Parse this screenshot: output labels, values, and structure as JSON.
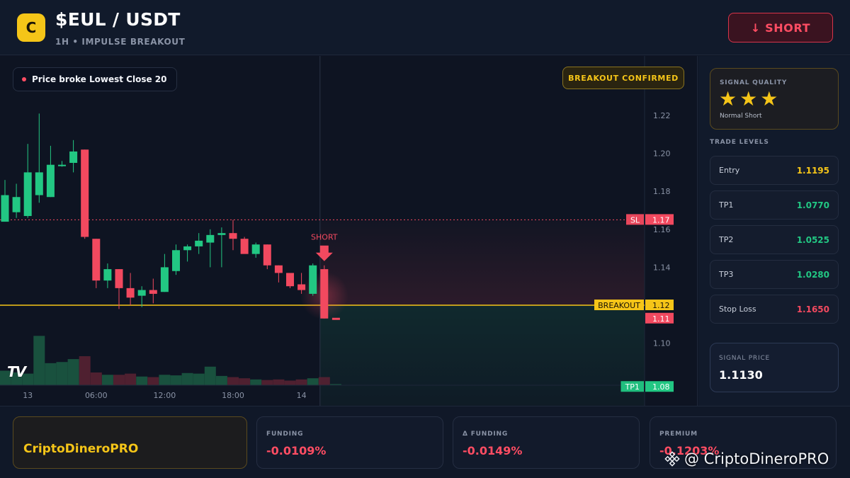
{
  "header": {
    "logo_letter": "C",
    "pair": "$EUL / USDT",
    "subtitle": "1H • IMPULSE BREAKOUT",
    "short_label": "↓ SHORT"
  },
  "chart": {
    "alert_text": "Price broke Lowest Close 20",
    "confirm_text": "BREAKOUT CONFIRMED",
    "short_marker": "SHORT",
    "tv_logo": "TV",
    "colors": {
      "up": "#22c783",
      "down": "#f2495f",
      "breakout": "#f5c518"
    }
  },
  "chart_data": {
    "type": "candlestick",
    "timeframe": "1H",
    "y_ticks": [
      "1.22",
      "1.20",
      "1.18",
      "1.16",
      "1.14",
      "1.10"
    ],
    "ylim": [
      1.075,
      1.235
    ],
    "x_ticks": [
      "13",
      "06:00",
      "12:00",
      "18:00",
      "14"
    ],
    "candles": [
      {
        "o": 1.164,
        "h": 1.186,
        "l": 1.165,
        "c": 1.178
      },
      {
        "o": 1.169,
        "h": 1.184,
        "l": 1.166,
        "c": 1.177
      },
      {
        "o": 1.167,
        "h": 1.205,
        "l": 1.166,
        "c": 1.19
      },
      {
        "o": 1.178,
        "h": 1.221,
        "l": 1.174,
        "c": 1.19
      },
      {
        "o": 1.177,
        "h": 1.204,
        "l": 1.177,
        "c": 1.194
      },
      {
        "o": 1.194,
        "h": 1.196,
        "l": 1.193,
        "c": 1.194
      },
      {
        "o": 1.195,
        "h": 1.207,
        "l": 1.19,
        "c": 1.201
      },
      {
        "o": 1.202,
        "h": 1.202,
        "l": 1.155,
        "c": 1.156
      },
      {
        "o": 1.155,
        "h": 1.155,
        "l": 1.129,
        "c": 1.133
      },
      {
        "o": 1.133,
        "h": 1.142,
        "l": 1.129,
        "c": 1.139
      },
      {
        "o": 1.139,
        "h": 1.139,
        "l": 1.118,
        "c": 1.129
      },
      {
        "o": 1.129,
        "h": 1.137,
        "l": 1.12,
        "c": 1.124
      },
      {
        "o": 1.125,
        "h": 1.13,
        "l": 1.119,
        "c": 1.128
      },
      {
        "o": 1.128,
        "h": 1.134,
        "l": 1.121,
        "c": 1.126
      },
      {
        "o": 1.127,
        "h": 1.147,
        "l": 1.127,
        "c": 1.14
      },
      {
        "o": 1.138,
        "h": 1.152,
        "l": 1.136,
        "c": 1.149
      },
      {
        "o": 1.149,
        "h": 1.152,
        "l": 1.143,
        "c": 1.151
      },
      {
        "o": 1.151,
        "h": 1.158,
        "l": 1.147,
        "c": 1.154
      },
      {
        "o": 1.153,
        "h": 1.16,
        "l": 1.14,
        "c": 1.157
      },
      {
        "o": 1.157,
        "h": 1.161,
        "l": 1.14,
        "c": 1.158
      },
      {
        "o": 1.158,
        "h": 1.165,
        "l": 1.149,
        "c": 1.155
      },
      {
        "o": 1.155,
        "h": 1.156,
        "l": 1.148,
        "c": 1.147
      },
      {
        "o": 1.147,
        "h": 1.153,
        "l": 1.145,
        "c": 1.152
      },
      {
        "o": 1.152,
        "h": 1.152,
        "l": 1.139,
        "c": 1.141
      },
      {
        "o": 1.141,
        "h": 1.141,
        "l": 1.132,
        "c": 1.137
      },
      {
        "o": 1.137,
        "h": 1.137,
        "l": 1.129,
        "c": 1.13
      },
      {
        "o": 1.131,
        "h": 1.137,
        "l": 1.126,
        "c": 1.128
      },
      {
        "o": 1.126,
        "h": 1.142,
        "l": 1.125,
        "c": 1.141
      },
      {
        "o": 1.139,
        "h": 1.141,
        "l": 1.113,
        "c": 1.113
      },
      {
        "o": 1.113,
        "h": 1.113,
        "l": 1.113,
        "c": 1.113
      }
    ],
    "volumes": [
      0.25,
      0.22,
      0.2,
      0.85,
      0.38,
      0.4,
      0.45,
      0.5,
      0.22,
      0.18,
      0.18,
      0.2,
      0.15,
      0.14,
      0.18,
      0.17,
      0.21,
      0.2,
      0.32,
      0.16,
      0.14,
      0.12,
      0.1,
      0.09,
      0.1,
      0.08,
      0.1,
      0.12,
      0.14,
      0.02
    ],
    "levels": [
      {
        "label": "SL",
        "price": 1.165,
        "display": "1.17",
        "color": "#f2495f",
        "style": "dotted"
      },
      {
        "label": "BREAKOUT",
        "price": 1.12,
        "display": "1.12",
        "color": "#f5c518",
        "style": "solid"
      },
      {
        "label": "",
        "price": 1.113,
        "display": "1.11",
        "color": "#f2495f",
        "style": "none"
      },
      {
        "label": "TP1",
        "price": 1.077,
        "display": "1.08",
        "color": "#22c783",
        "style": "none"
      }
    ]
  },
  "side": {
    "quality_label": "SIGNAL QUALITY",
    "stars": [
      "★",
      "★",
      "★"
    ],
    "quality_note": "Normal Short",
    "levels_title": "TRADE LEVELS",
    "levels": [
      {
        "label": "Entry",
        "value": "1.1195",
        "color": "#f5c518"
      },
      {
        "label": "TP1",
        "value": "1.0770",
        "color": "#22c783"
      },
      {
        "label": "TP2",
        "value": "1.0525",
        "color": "#22c783"
      },
      {
        "label": "TP3",
        "value": "1.0280",
        "color": "#22c783"
      },
      {
        "label": "Stop Loss",
        "value": "1.1650",
        "color": "#f2495f"
      }
    ],
    "signal_price_label": "SIGNAL PRICE",
    "signal_price": "1.1130"
  },
  "footer": {
    "brand": "CriptoDineroPRO",
    "stats": [
      {
        "label": "FUNDING",
        "value": "-0.0109%"
      },
      {
        "label": "Δ FUNDING",
        "value": "-0.0149%"
      },
      {
        "label": "PREMIUM",
        "value": "-0.1203%"
      }
    ],
    "watermark": "@ CriptoDineroPRO"
  }
}
